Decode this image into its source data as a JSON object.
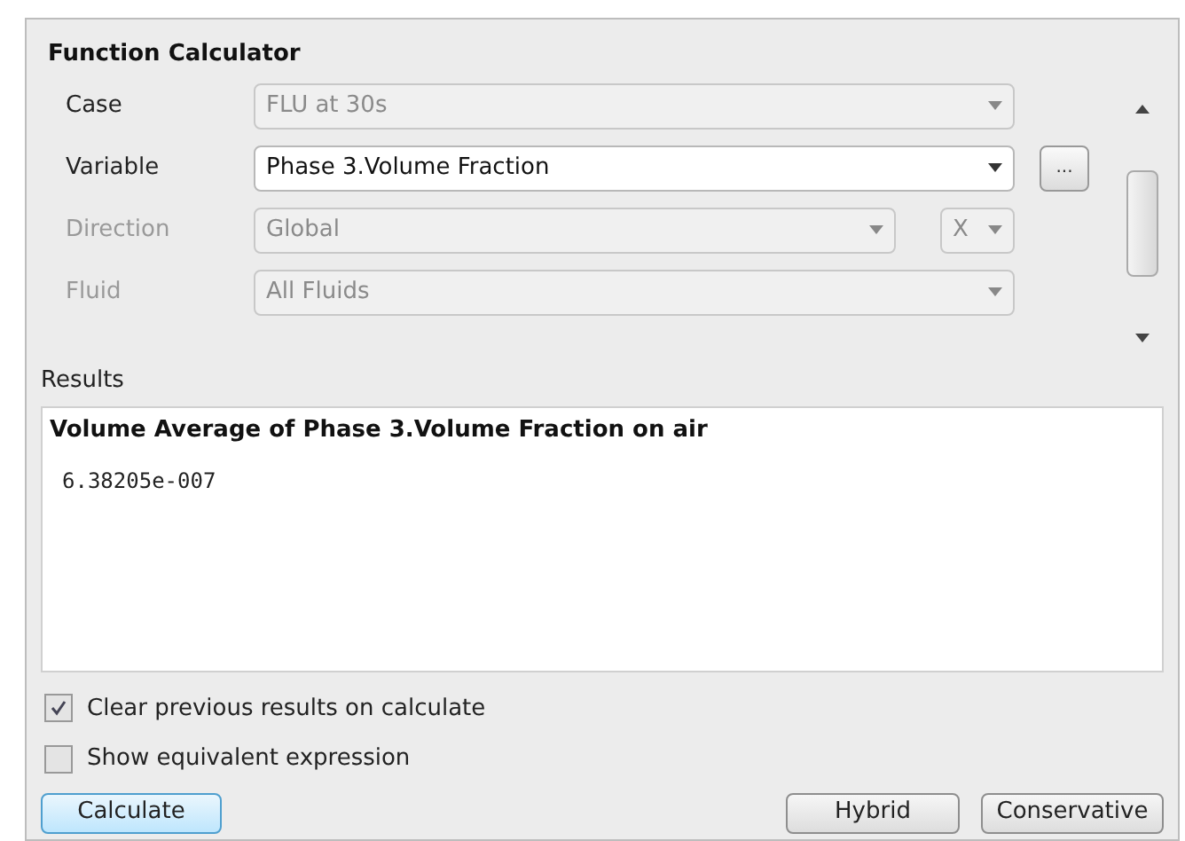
{
  "title": "Function Calculator",
  "rows": [
    {
      "label": "Case",
      "label_disabled": false,
      "value": "FLU at 30s",
      "disabled": true
    },
    {
      "label": "Variable",
      "label_disabled": false,
      "value": "Phase 3.Volume Fraction",
      "disabled": false,
      "extra": {
        "kind": "button",
        "label": "..."
      }
    },
    {
      "label": "Direction",
      "label_disabled": true,
      "value": "Global",
      "disabled": true,
      "extra": {
        "kind": "combo",
        "value": "X"
      }
    },
    {
      "label": "Fluid",
      "label_disabled": true,
      "value": "All Fluids",
      "disabled": true
    }
  ],
  "results": {
    "label": "Results",
    "heading": "Volume Average of Phase 3.Volume Fraction on air",
    "value": "6.38205e-007"
  },
  "options": [
    {
      "label": "Clear previous results on calculate",
      "checked": true
    },
    {
      "label": "Show equivalent expression",
      "checked": false
    }
  ],
  "buttons": [
    {
      "label": "Calculate",
      "selected": true
    },
    {
      "label": "Hybrid",
      "selected": false
    },
    {
      "label": "Conservative",
      "selected": false
    }
  ]
}
